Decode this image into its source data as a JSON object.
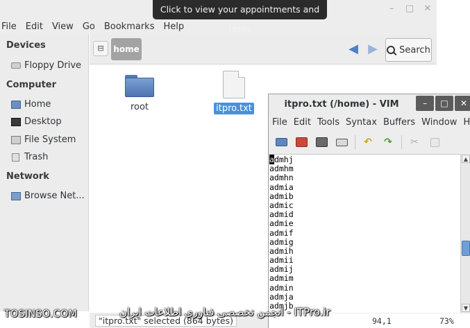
{
  "tooltip": "Click to view your appointments and tasks",
  "nautilus": {
    "window_buttons": [
      "–",
      "□",
      "✕"
    ],
    "menu": [
      "File",
      "Edit",
      "View",
      "Go",
      "Bookmarks",
      "Help"
    ],
    "sidebar": {
      "devices_heading": "Devices",
      "floppy": "Floppy Drive",
      "computer_heading": "Computer",
      "home": "Home",
      "desktop": "Desktop",
      "filesystem": "File System",
      "trash": "Trash",
      "network_heading": "Network",
      "browse_network": "Browse Net..."
    },
    "toolbar": {
      "path_toggle": "⊟",
      "path_home": "home",
      "back": "◀",
      "forward": "▶",
      "search": "Search"
    },
    "files": [
      {
        "name": "root",
        "type": "folder",
        "selected": false
      },
      {
        "name": "itpro.txt",
        "type": "text",
        "selected": true
      }
    ],
    "status": "\"itpro.txt\" selected (864 bytes)"
  },
  "vim": {
    "title": "itpro.txt (/home) - VIM",
    "window_buttons": [
      "–",
      "□",
      "✕"
    ],
    "menu": [
      "File",
      "Edit",
      "Tools",
      "Syntax",
      "Buffers",
      "Window",
      "H"
    ],
    "toolbar_icons": [
      "open-icon",
      "save-icon",
      "save-all-icon",
      "print-icon",
      "undo-icon",
      "redo-icon",
      "cut-icon",
      "copy-icon"
    ],
    "lines": [
      "admhj",
      "admhm",
      "admhn",
      "admia",
      "admib",
      "admic",
      "admid",
      "admie",
      "admif",
      "admig",
      "admih",
      "admii",
      "admij",
      "admim",
      "admin",
      "admja",
      "admjb"
    ],
    "cursor_line": 0,
    "position": "94,1",
    "percent": "73%"
  },
  "watermark": {
    "left": "TOSINSO.COM",
    "right": "انجمن تخصصی فناوری اطلاعات ایران - ITPro.ir"
  }
}
